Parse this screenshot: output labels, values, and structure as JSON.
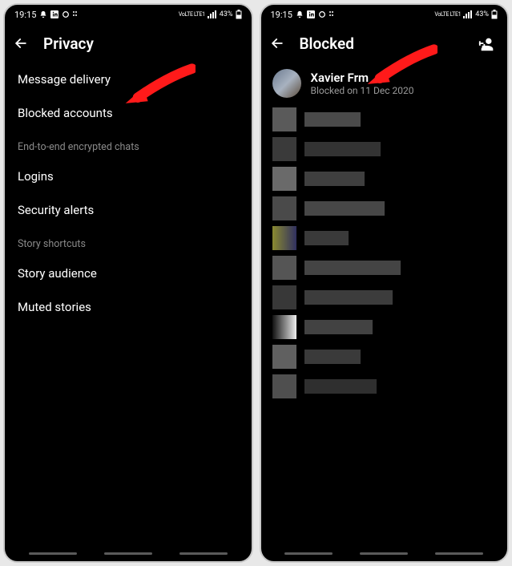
{
  "status": {
    "time": "19:15",
    "battery": "43%",
    "network_label": "VoLTE LTE1"
  },
  "screen1": {
    "title": "Privacy",
    "items": [
      {
        "label": "Message delivery"
      },
      {
        "label": "Blocked accounts"
      }
    ],
    "section_e2e": "End-to-end encrypted chats",
    "items_e2e": [
      {
        "label": "Logins"
      },
      {
        "label": "Security alerts"
      }
    ],
    "section_story": "Story shortcuts",
    "items_story": [
      {
        "label": "Story audience"
      },
      {
        "label": "Muted stories"
      }
    ]
  },
  "screen2": {
    "title": "Blocked",
    "first_user": {
      "name": "Xavier Frm",
      "subtitle": "Blocked on 11 Dec 2020"
    }
  },
  "colors": {
    "arrow": "#ff1a1a"
  }
}
